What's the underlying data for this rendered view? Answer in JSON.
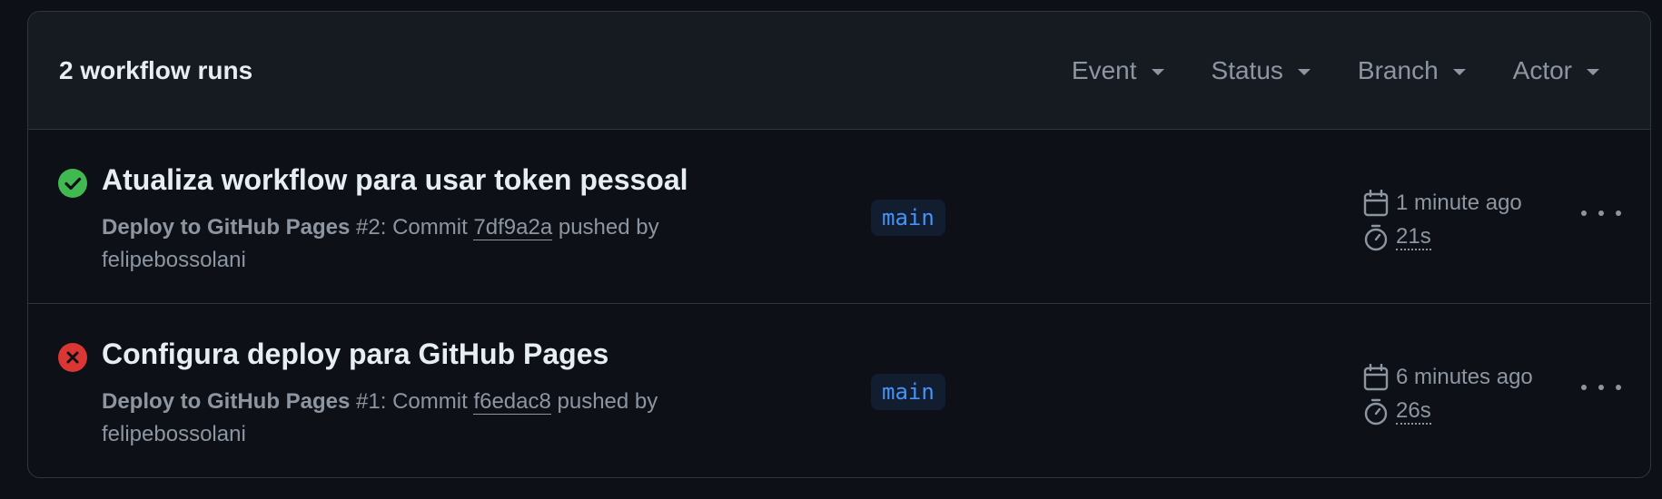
{
  "header": {
    "runs_count": "2 workflow runs",
    "filters": [
      "Event",
      "Status",
      "Branch",
      "Actor"
    ]
  },
  "runs": [
    {
      "status": "success",
      "status_icon": "check-circle-icon",
      "status_color": "#3fb950",
      "title": "Atualiza workflow para usar token pessoal",
      "workflow": "Deploy to GitHub Pages",
      "run_number": "#2",
      "commit_prefix": ": Commit",
      "commit_sha": "7df9a2a",
      "pushed_by_label": "pushed by",
      "actor": "felipebossolani",
      "branch": "main",
      "time_ago": "1 minute ago",
      "duration": "21s"
    },
    {
      "status": "failure",
      "status_icon": "x-circle-icon",
      "status_color": "#da3633",
      "title": "Configura deploy para GitHub Pages",
      "workflow": "Deploy to GitHub Pages",
      "run_number": "#1",
      "commit_prefix": ": Commit",
      "commit_sha": "f6edac8",
      "pushed_by_label": "pushed by",
      "actor": "felipebossolani",
      "branch": "main",
      "time_ago": "6 minutes ago",
      "duration": "26s"
    }
  ]
}
